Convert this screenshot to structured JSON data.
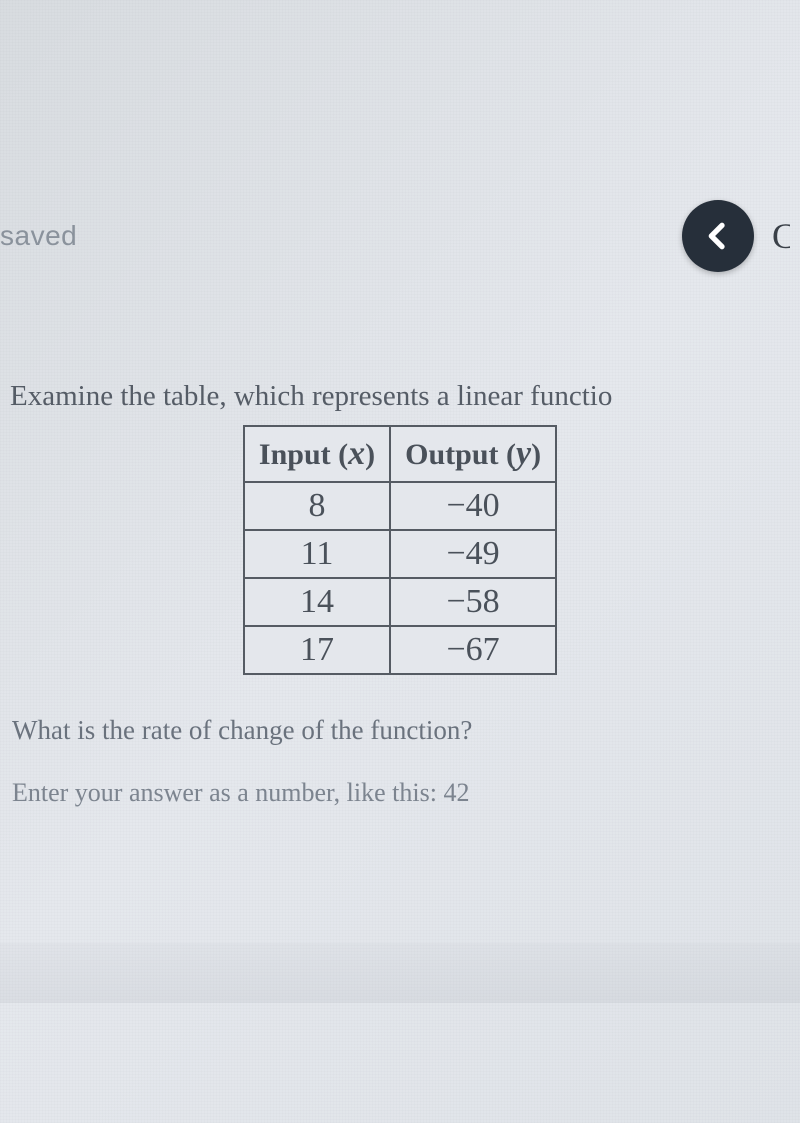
{
  "status": {
    "saved_label": "saved"
  },
  "nav": {
    "partial_next_char": "C"
  },
  "question": {
    "prompt": "Examine the table, which represents a linear functio",
    "sub_prompt": "What is the rate of change of the function?",
    "instruction": "Enter your answer as a number, like this: 42"
  },
  "table": {
    "header_input": "Input (x)",
    "header_output": "Output (y)",
    "rows": [
      {
        "x": "8",
        "y": "−40"
      },
      {
        "x": "11",
        "y": "−49"
      },
      {
        "x": "14",
        "y": "−58"
      },
      {
        "x": "17",
        "y": "−67"
      }
    ]
  },
  "chart_data": {
    "type": "table",
    "title": "Linear function input-output table",
    "columns": [
      "Input (x)",
      "Output (y)"
    ],
    "x": [
      8,
      11,
      14,
      17
    ],
    "y": [
      -40,
      -49,
      -58,
      -67
    ]
  }
}
